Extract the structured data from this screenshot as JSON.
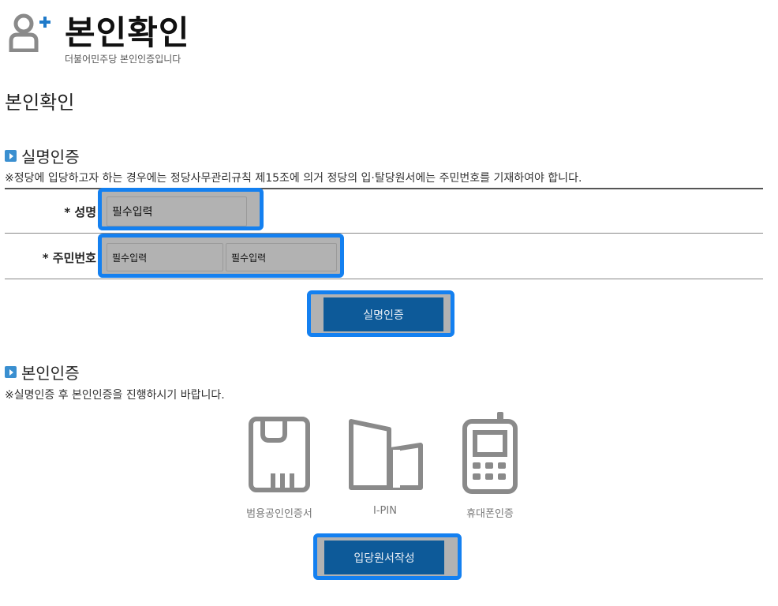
{
  "header": {
    "title": "본인확인",
    "subtitle": "더불어민주당 본인인증입니다",
    "icon": "user-add-icon"
  },
  "section_title": "본인확인",
  "realname": {
    "heading": "실명인증",
    "note": "※정당에 입당하고자 하는 경우에는 정당사무관리규칙 제15조에 의거 정당의 입·탈당원서에는 주민번호를 기재하여야 합니다.",
    "name_label": "* 성명",
    "name_placeholder": "필수입력",
    "rrn_label": "* 주민번호",
    "rrn_front_placeholder": "필수입력",
    "rrn_back_placeholder": "필수입력",
    "button_label": "실명인증"
  },
  "identity": {
    "heading": "본인인증",
    "note": "※실명인증 후 본인인증을 진행하시기 바랍니다.",
    "methods": [
      {
        "label": "범용공인인증서",
        "icon": "certificate-card-icon"
      },
      {
        "label": "I-PIN",
        "icon": "ipin-icon"
      },
      {
        "label": "휴대폰인증",
        "icon": "mobile-phone-icon"
      }
    ],
    "submit_label": "입당원서작성"
  },
  "colors": {
    "accent": "#1480f0",
    "button": "#0d5a99",
    "icon_gray": "#8a8a8a"
  }
}
